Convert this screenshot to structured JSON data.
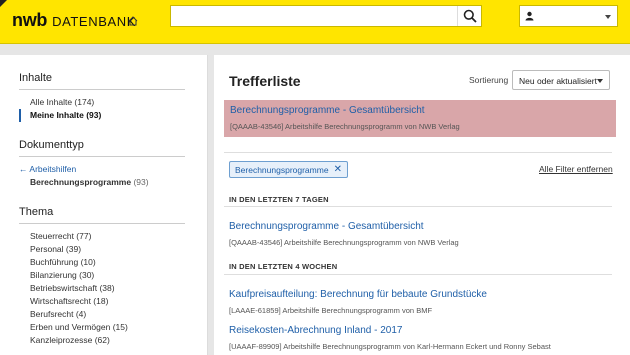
{
  "header": {
    "logo_main": "nwb",
    "logo_sub": "DATENBANK",
    "search_placeholder": "",
    "search_value": "",
    "colors": {
      "brand_yellow": "#ffe500",
      "link_blue": "#1f5fa8",
      "highlight": "#d9a6a9"
    }
  },
  "sidebar": {
    "inhalte": {
      "title": "Inhalte",
      "items": [
        {
          "label": "Alle Inhalte (174)"
        },
        {
          "label": "Meine Inhalte (93)"
        }
      ]
    },
    "dokumenttyp": {
      "title": "Dokumenttyp",
      "back": "Arbeitshilfen",
      "current": {
        "name": "Berechnungsprogramme",
        "count": "(93)"
      }
    },
    "thema": {
      "title": "Thema",
      "items": [
        "Steuerrecht (77)",
        "Personal (39)",
        "Buchführung (10)",
        "Bilanzierung (30)",
        "Betriebswirtschaft (38)",
        "Wirtschaftsrecht (18)",
        "Berufsrecht (4)",
        "Erben und Vermögen (15)",
        "Kanzleiprozesse (62)"
      ]
    }
  },
  "main": {
    "title": "Trefferliste",
    "sort_label": "Sortierung",
    "sort_value": "Neu oder aktualisiert",
    "featured": {
      "title": "Berechnungsprogramme - Gesamtübersicht",
      "meta": "[QAAAB-43546] Arbeitshilfe Berechnungsprogramm von NWB Verlag"
    },
    "filter_chip": "Berechnungsprogramme",
    "clear_filters": "Alle Filter entfernen",
    "sections": [
      {
        "heading": "IN DEN LETZTEN 7 TAGEN",
        "hits": [
          {
            "title": "Berechnungsprogramme - Gesamtübersicht",
            "meta": "[QAAAB-43546] Arbeitshilfe Berechnungsprogramm von NWB Verlag"
          }
        ]
      },
      {
        "heading": "IN DEN LETZTEN 4 WOCHEN",
        "hits": [
          {
            "title": "Kaufpreisaufteilung: Berechnung für bebaute Grundstücke",
            "meta": "[LAAAE-61859] Arbeitshilfe Berechnungsprogramm von BMF"
          },
          {
            "title": "Reisekosten-Abrechnung Inland - 2017",
            "meta": "[UAAAF-89909] Arbeitshilfe Berechnungsprogramm von Karl-Hermann Eckert und Ronny Sebast"
          }
        ]
      }
    ]
  }
}
